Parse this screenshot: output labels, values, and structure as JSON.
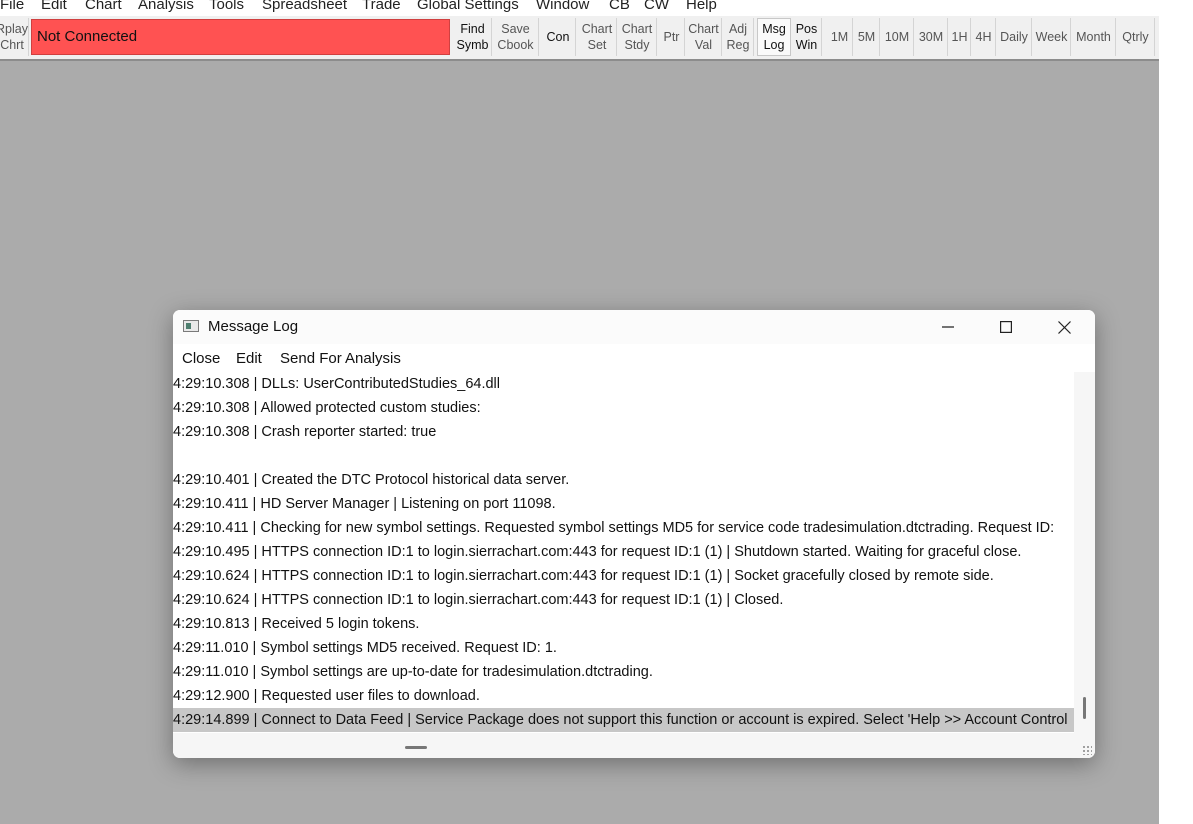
{
  "main_menu": [
    "File",
    "Edit",
    "Chart",
    "Analysis",
    "Tools",
    "Spreadsheet",
    "Trade",
    "Global Settings",
    "Window",
    "CB",
    "CW",
    "Help"
  ],
  "toolbar": {
    "replay": [
      "Rplay",
      "Chrt"
    ],
    "status": "Not Connected",
    "status_color": "#ff5252",
    "buttons": [
      {
        "l1": "Find",
        "l2": "Symb"
      },
      {
        "l1": "Save",
        "l2": "Cbook"
      },
      {
        "l1": "Con",
        "l2": ""
      },
      {
        "l1": "Chart",
        "l2": "Set"
      },
      {
        "l1": "Chart",
        "l2": "Stdy"
      },
      {
        "l1": "Ptr",
        "l2": ""
      },
      {
        "l1": "Chart",
        "l2": "Val"
      },
      {
        "l1": "Adj",
        "l2": "Reg"
      },
      {
        "l1": "Msg",
        "l2": "Log"
      },
      {
        "l1": "Pos",
        "l2": "Win"
      }
    ],
    "timeframes": [
      "1M",
      "5M",
      "10M",
      "30M",
      "1H",
      "4H",
      "Daily",
      "Week",
      "Month",
      "Qtrly"
    ]
  },
  "window": {
    "title": "Message Log",
    "menu": [
      "Close",
      "Edit",
      "Send For Analysis"
    ],
    "lines": [
      "4:29:10.308 | DLLs: UserContributedStudies_64.dll",
      "4:29:10.308 | Allowed protected custom studies:",
      "4:29:10.308 | Crash reporter started: true",
      "",
      "4:29:10.401 | Created the DTC Protocol historical data server.",
      "4:29:10.411 | HD Server Manager | Listening on port 11098.",
      "4:29:10.411 | Checking for new symbol settings.  Requested symbol settings MD5 for service code tradesimulation.dtctrading.  Request ID:",
      "4:29:10.495 | HTTPS connection ID:1 to login.sierrachart.com:443 for request ID:1 (1) | Shutdown started.  Waiting for graceful close.",
      "4:29:10.624 | HTTPS connection ID:1 to login.sierrachart.com:443 for request ID:1 (1) | Socket gracefully closed by remote side.",
      "4:29:10.624 | HTTPS connection ID:1 to login.sierrachart.com:443 for request ID:1 (1) | Closed.",
      "4:29:10.813 | Received 5 login tokens.",
      "4:29:11.010 | Symbol settings MD5 received.  Request ID: 1.",
      "4:29:11.010 | Symbol settings are up-to-date for tradesimulation.dtctrading.",
      "4:29:12.900 | Requested user files to download.",
      "4:29:14.899 | Connect to Data Feed | Service Package does not support this function or account is expired. Select 'Help >> Account Control"
    ]
  }
}
